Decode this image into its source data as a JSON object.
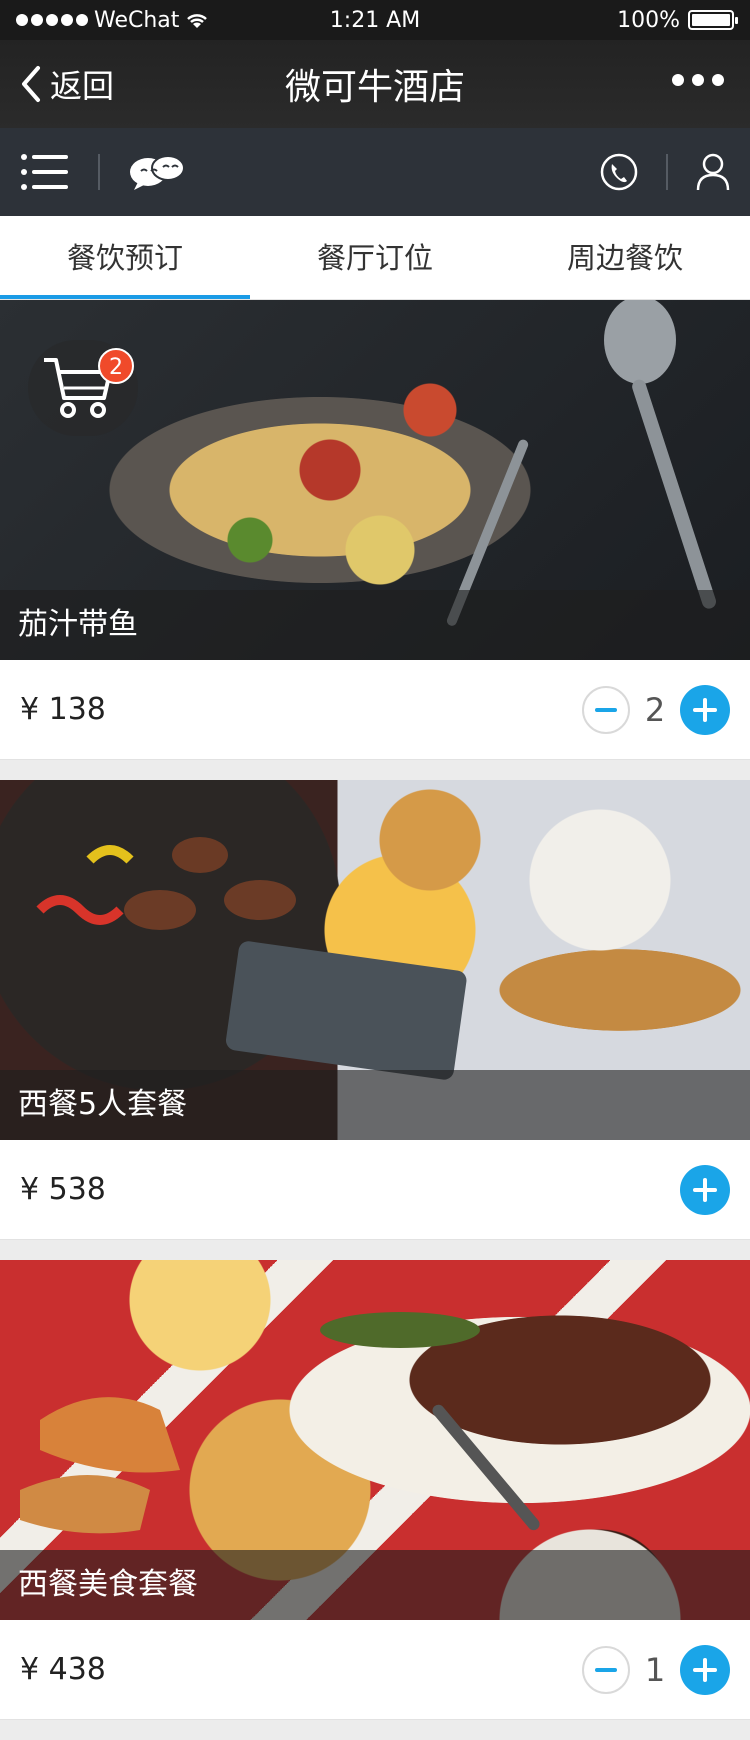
{
  "status_bar": {
    "carrier": "WeChat",
    "time": "1:21 AM",
    "battery": "100%"
  },
  "nav": {
    "back_label": "返回",
    "title": "微可牛酒店"
  },
  "tabs": [
    {
      "label": "餐饮预订",
      "active": true
    },
    {
      "label": "餐厅订位",
      "active": false
    },
    {
      "label": "周边餐饮",
      "active": false
    }
  ],
  "cart": {
    "count": "2"
  },
  "items": [
    {
      "name": "茄汁带鱼",
      "price": "¥ 138",
      "qty": "2"
    },
    {
      "name": "西餐5人套餐",
      "price": "¥ 538"
    },
    {
      "name": "西餐美食套餐",
      "price": "¥ 438",
      "qty": "1"
    }
  ],
  "colors": {
    "accent": "#1aa5e8",
    "badge": "#f04a2a",
    "toolbar": "#2d3239"
  },
  "icons": [
    "signal-dots-icon",
    "wifi-icon",
    "battery-icon",
    "back-chevron-icon",
    "more-icon",
    "menu-list-icon",
    "chat-bubbles-icon",
    "phone-icon",
    "user-icon",
    "cart-icon"
  ]
}
